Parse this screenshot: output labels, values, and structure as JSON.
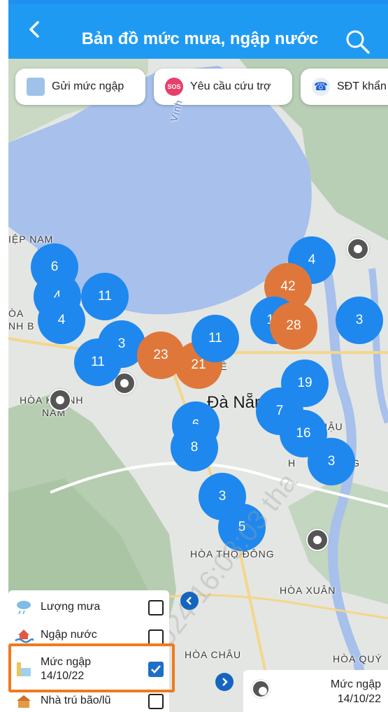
{
  "header": {
    "title": "Bản đồ mức mưa, ngập nước",
    "back_icon": "chevron-left-icon",
    "search_icon": "search-icon",
    "color": "#1f9af3"
  },
  "chips": [
    {
      "label": "Gửi mức ngập",
      "icon": "flood-level-icon"
    },
    {
      "label": "Yêu cầu cứu trợ",
      "icon": "sos-icon"
    },
    {
      "label": "SĐT khẩn",
      "icon": "phone-icon"
    }
  ],
  "map": {
    "water_label": "Vịnh",
    "city": "Đà Nẵng",
    "places": [
      "IỆP NAM",
      "ÒA",
      "NH B",
      "HÒA KHÁNH",
      "NAM",
      "HÊ",
      "HÒA THỌ ĐÔNG",
      "HÒA XUÂN",
      "HÒA CHÂU",
      "HÒA QUÝ",
      "HẬU",
      "H",
      "NG"
    ],
    "clusters": [
      {
        "value": "6",
        "status": "blue"
      },
      {
        "value": "4",
        "status": "blue"
      },
      {
        "value": "11",
        "status": "blue"
      },
      {
        "value": "4",
        "status": "blue"
      },
      {
        "value": "3",
        "status": "blue"
      },
      {
        "value": "11",
        "status": "blue"
      },
      {
        "value": "23",
        "status": "orange"
      },
      {
        "value": "21",
        "status": "orange"
      },
      {
        "value": "11",
        "status": "blue"
      },
      {
        "value": "4",
        "status": "blue"
      },
      {
        "value": "42",
        "status": "orange"
      },
      {
        "value": "10",
        "status": "blue"
      },
      {
        "value": "28",
        "status": "orange"
      },
      {
        "value": "3",
        "status": "blue"
      },
      {
        "value": "19",
        "status": "blue"
      },
      {
        "value": "7",
        "status": "blue"
      },
      {
        "value": "16",
        "status": "blue"
      },
      {
        "value": "3",
        "status": "blue"
      },
      {
        "value": "6",
        "status": "blue"
      },
      {
        "value": "8",
        "status": "blue"
      },
      {
        "value": "3",
        "status": "blue"
      },
      {
        "value": "5",
        "status": "blue"
      }
    ],
    "cluster_colors": {
      "blue": "#1e88ee",
      "orange": "#e0773a"
    }
  },
  "legend": {
    "items": [
      {
        "label": "Lượng mưa",
        "checked": false,
        "icon": "rain-cloud-icon"
      },
      {
        "label": "Ngập nước",
        "checked": false,
        "icon": "flood-water-icon"
      },
      {
        "label": "Mức ngập 14/10/22",
        "label_line1": "Mức ngập",
        "label_line2": "14/10/22",
        "checked": true,
        "icon": "water-level-icon"
      },
      {
        "label": "Nhà trú bão/lũ",
        "checked": false,
        "icon": "shelter-icon"
      }
    ],
    "highlight_color": "#f07a1e"
  },
  "collapse_button_icon": "chevron-left-icon",
  "expand_button_icon": "chevron-right-icon",
  "info_card": {
    "line1": "Mức ngập",
    "line2": "14/10/22",
    "icon": "location-pin-icon"
  },
  "watermark": "02/10/2024 16:03:03 tha"
}
